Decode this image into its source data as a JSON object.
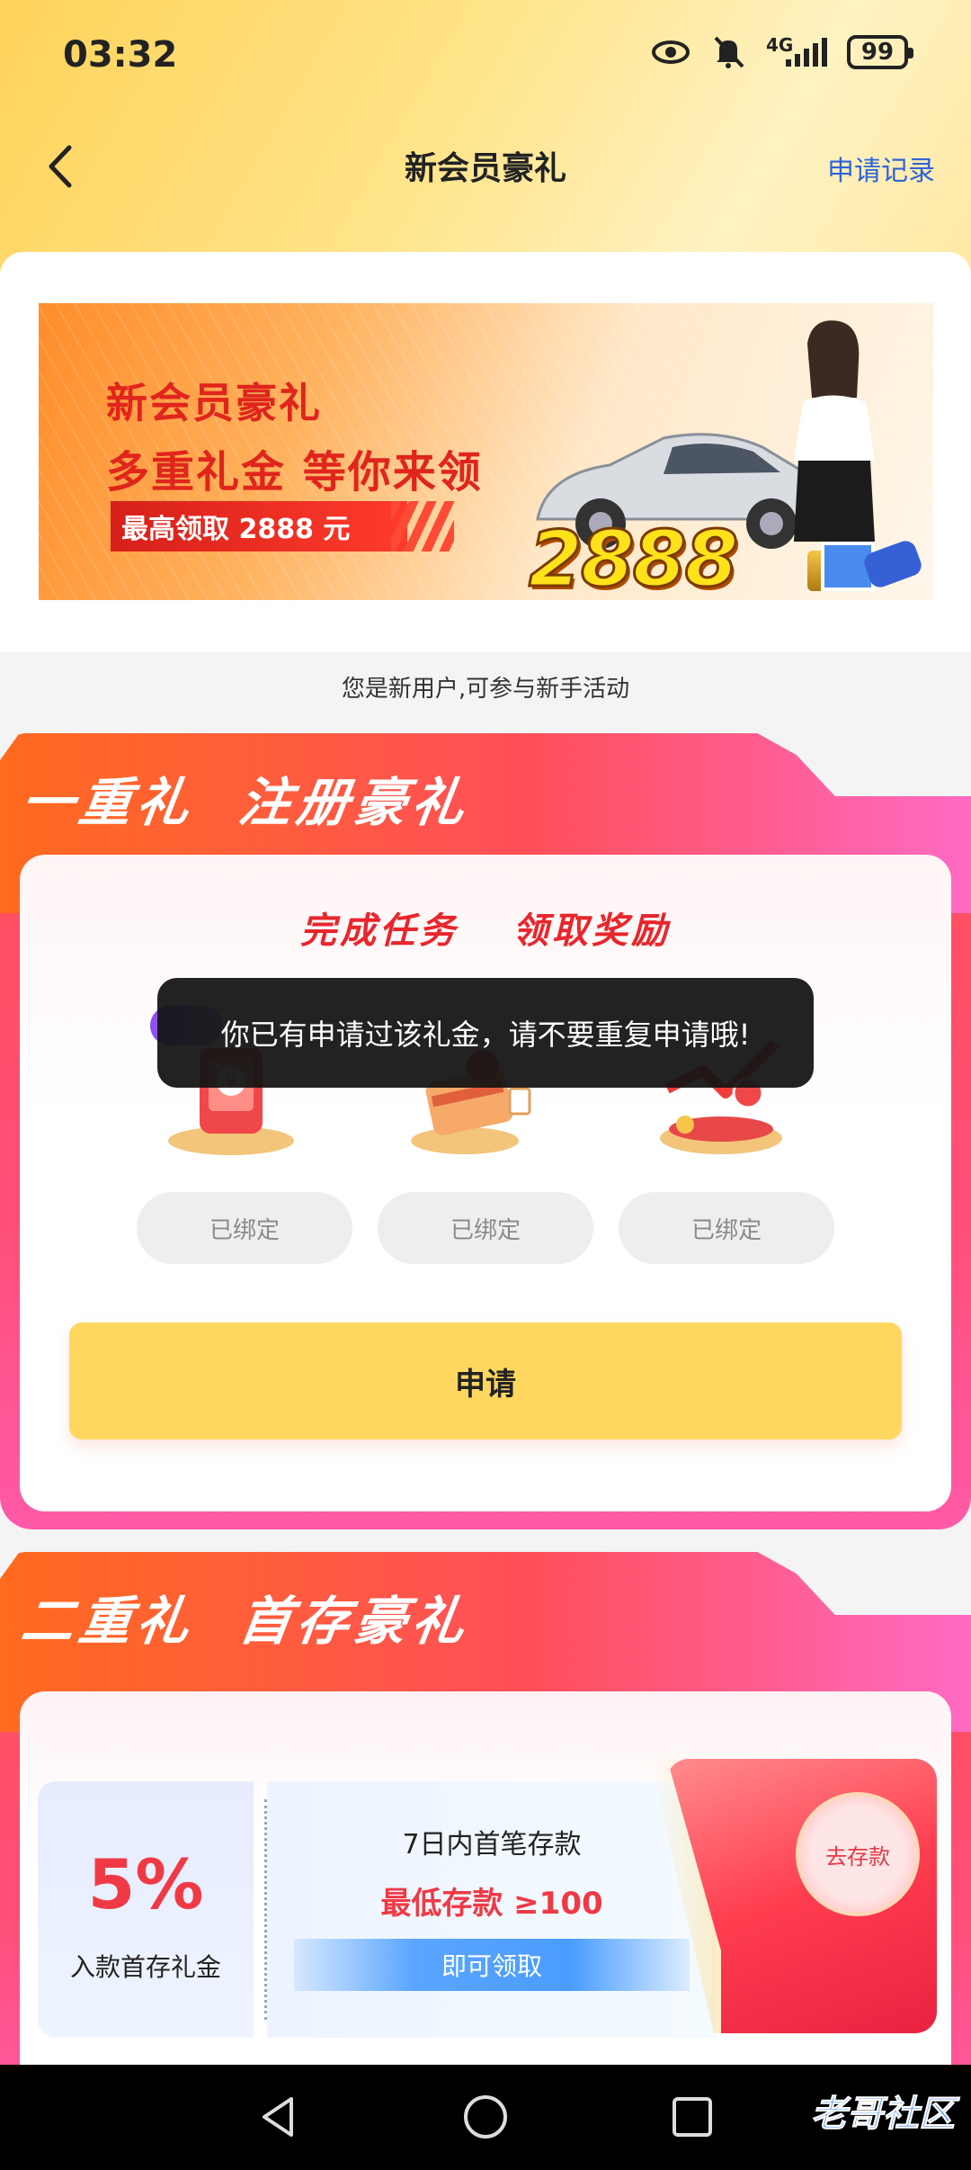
{
  "status_bar": {
    "time": "03:32",
    "network": "4G",
    "battery": "99"
  },
  "nav": {
    "title": "新会员豪礼",
    "right_link": "申请记录"
  },
  "banner": {
    "line1": "新会员豪礼",
    "line2": "多重礼金 等你来领",
    "tag": "最高领取 2888 元",
    "big_amount": "2888"
  },
  "new_user_tip": "您是新用户,可参与新手活动",
  "section1": {
    "title_a": "一重礼",
    "title_b": "注册豪礼",
    "slogan_a": "完成任务",
    "slogan_b": "领取奖励",
    "bind_buttons": [
      "已绑定",
      "已绑定",
      "已绑定"
    ],
    "apply_label": "申请"
  },
  "toast": {
    "message": "你已有申请过该礼金，请不要重复申请哦!"
  },
  "section2": {
    "title_a": "二重礼",
    "title_b": "首存豪礼",
    "coupon": {
      "percent": "5%",
      "percent_caption": "入款首存礼金",
      "condition": "7日内首笔存款",
      "min_deposit": "最低存款 ≥100",
      "claim_label": "即可领取",
      "deposit_button": "去存款"
    }
  },
  "watermark": "老哥社区",
  "colors": {
    "accent_red": "#e8262c",
    "link_blue": "#2f63d8",
    "apply_yellow": "#ffd75e"
  }
}
